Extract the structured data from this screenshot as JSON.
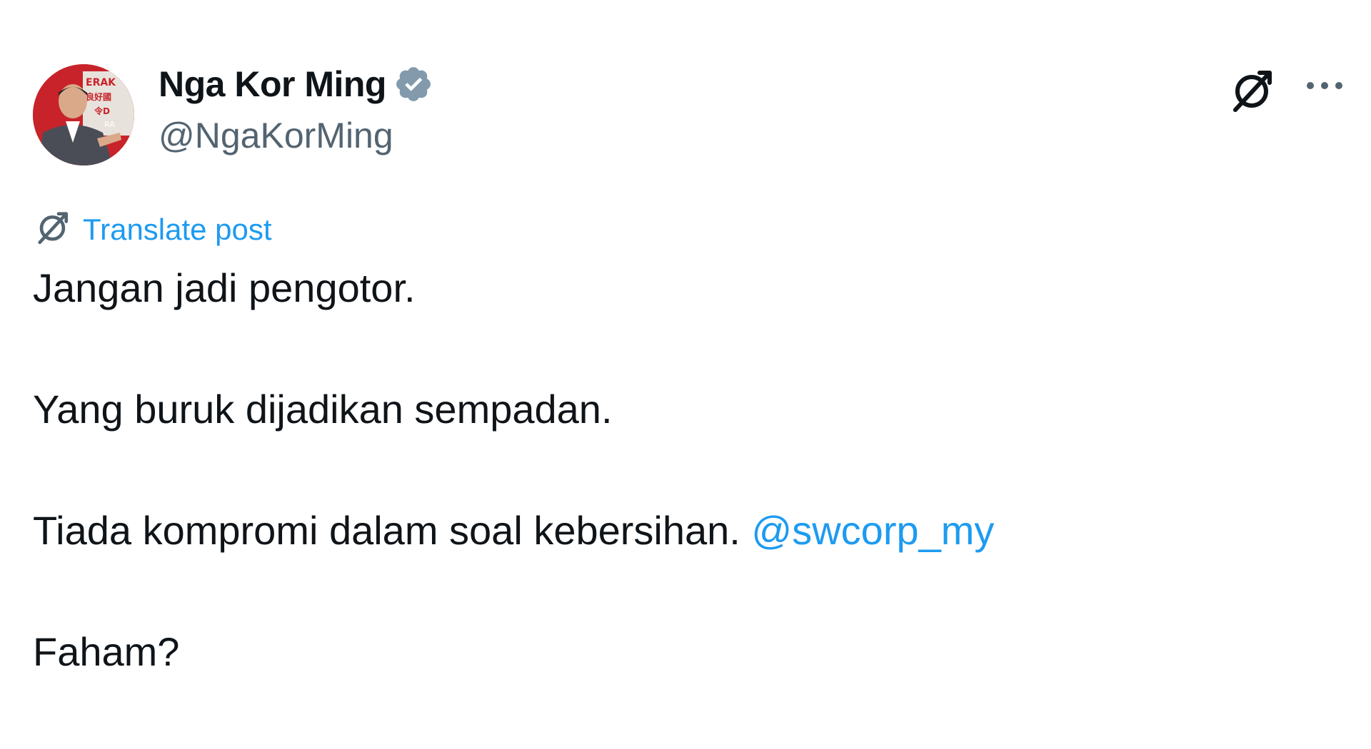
{
  "author": {
    "display_name": "Nga Kor Ming",
    "handle": "@NgaKorMing",
    "verified_icon": "verified-badge-icon",
    "avatar_sign_text": [
      "ERAK",
      "良好國",
      "令D",
      "RA"
    ]
  },
  "actions": {
    "translate_icon": "translate-icon",
    "more_icon": "more-dots-icon"
  },
  "translate": {
    "label": "Translate post",
    "icon": "translate-icon"
  },
  "tweet": {
    "line1": "Jangan jadi pengotor.",
    "line2": "Yang buruk dijadikan sempadan.",
    "line3_text": "Tiada kompromi dalam soal kebersihan. ",
    "line3_mention": "@swcorp_my",
    "line4": "Faham?"
  },
  "colors": {
    "link": "#1d9bf0",
    "secondary_text": "#536471",
    "primary_text": "#0f1419",
    "verified": "#829aab"
  }
}
